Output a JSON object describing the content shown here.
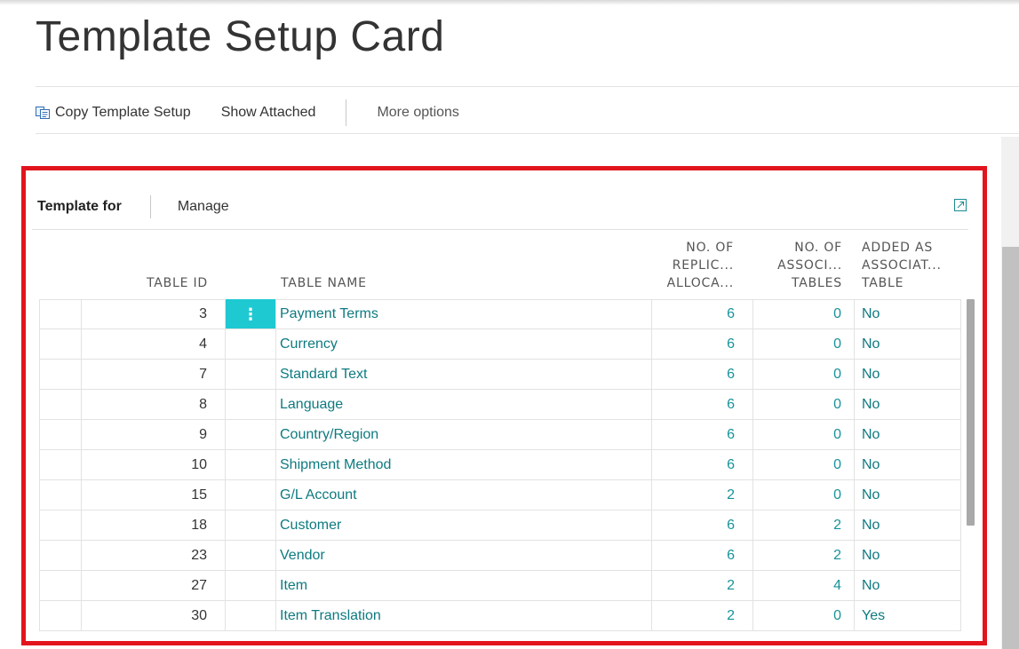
{
  "page": {
    "title": "Template Setup Card"
  },
  "actions": {
    "copy_template_setup": "Copy Template Setup",
    "show_attached": "Show Attached",
    "more_options": "More options"
  },
  "part": {
    "title": "Template for",
    "manage": "Manage",
    "columns": {
      "table_id": "TABLE ID",
      "table_name": "TABLE NAME",
      "no_of_replic": [
        "NO. OF",
        "REPLIC...",
        "ALLOCA..."
      ],
      "no_of_assoc": [
        "NO. OF",
        "ASSOCI...",
        "TABLES"
      ],
      "added_as": [
        "ADDED AS",
        "ASSOCIAT...",
        "TABLE"
      ]
    },
    "rows": [
      {
        "table_id": "3",
        "table_name": "Payment Terms",
        "no_of_replic": "6",
        "no_of_assoc": "0",
        "added_as": "No"
      },
      {
        "table_id": "4",
        "table_name": "Currency",
        "no_of_replic": "6",
        "no_of_assoc": "0",
        "added_as": "No"
      },
      {
        "table_id": "7",
        "table_name": "Standard Text",
        "no_of_replic": "6",
        "no_of_assoc": "0",
        "added_as": "No"
      },
      {
        "table_id": "8",
        "table_name": "Language",
        "no_of_replic": "6",
        "no_of_assoc": "0",
        "added_as": "No"
      },
      {
        "table_id": "9",
        "table_name": "Country/Region",
        "no_of_replic": "6",
        "no_of_assoc": "0",
        "added_as": "No"
      },
      {
        "table_id": "10",
        "table_name": "Shipment Method",
        "no_of_replic": "6",
        "no_of_assoc": "0",
        "added_as": "No"
      },
      {
        "table_id": "15",
        "table_name": "G/L Account",
        "no_of_replic": "2",
        "no_of_assoc": "0",
        "added_as": "No"
      },
      {
        "table_id": "18",
        "table_name": "Customer",
        "no_of_replic": "6",
        "no_of_assoc": "2",
        "added_as": "No"
      },
      {
        "table_id": "23",
        "table_name": "Vendor",
        "no_of_replic": "6",
        "no_of_assoc": "2",
        "added_as": "No"
      },
      {
        "table_id": "27",
        "table_name": "Item",
        "no_of_replic": "2",
        "no_of_assoc": "4",
        "added_as": "No"
      },
      {
        "table_id": "30",
        "table_name": "Item Translation",
        "no_of_replic": "2",
        "no_of_assoc": "0",
        "added_as": "Yes"
      }
    ]
  },
  "icons": {
    "copy": "copy-icon",
    "expand": "expand-icon",
    "row_actions": "row-actions-icon"
  },
  "colors": {
    "accent": "#0e7a80",
    "selection": "#1fc9d2",
    "highlight": "#e2151e"
  }
}
